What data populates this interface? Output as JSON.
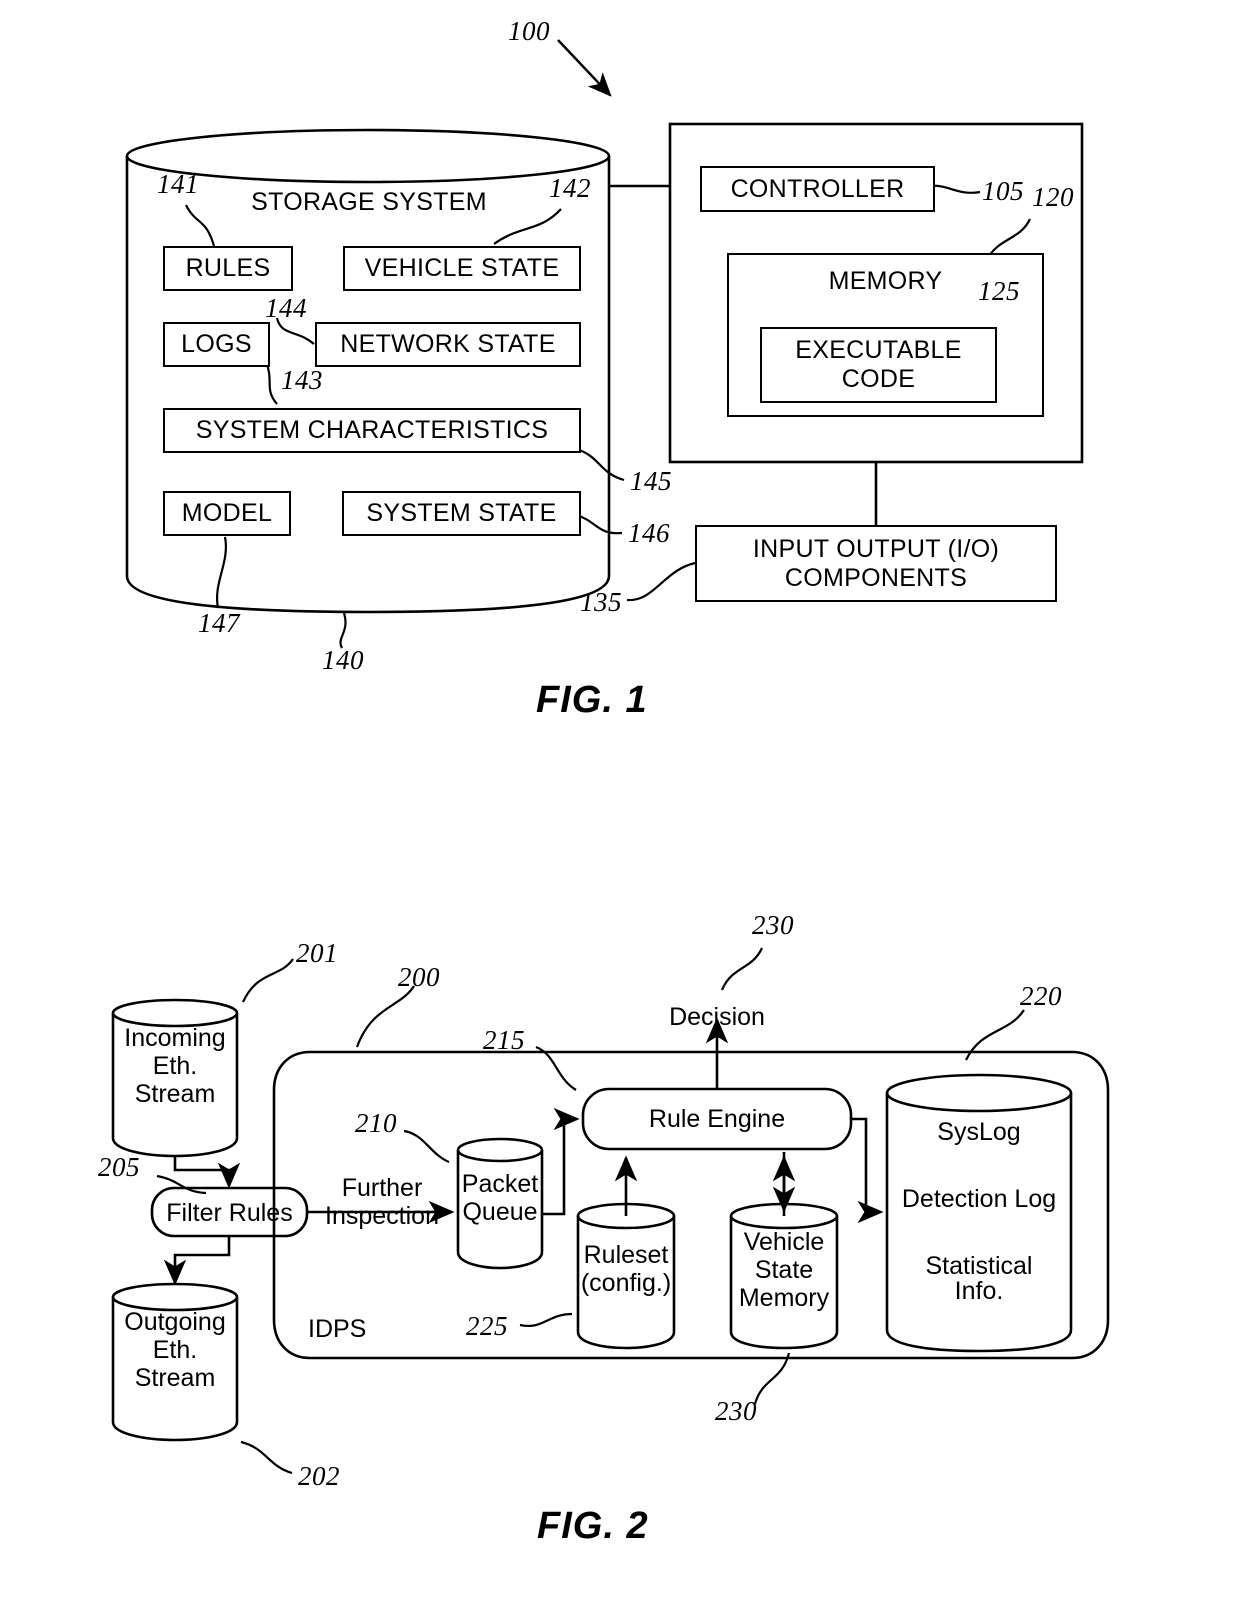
{
  "figures": [
    {
      "id": "fig1",
      "caption": "FIG. 1",
      "system_ref": "100",
      "storage": {
        "title": "STORAGE SYSTEM",
        "ref": "140",
        "items": [
          {
            "label": "RULES",
            "ref": "141"
          },
          {
            "label": "VEHICLE STATE",
            "ref": "142"
          },
          {
            "label": "LOGS",
            "ref": "143"
          },
          {
            "label": "NETWORK STATE",
            "ref": "144"
          },
          {
            "label": "SYSTEM CHARACTERISTICS",
            "ref": "145"
          },
          {
            "label": "MODEL",
            "ref": "147"
          },
          {
            "label": "SYSTEM STATE",
            "ref": "146"
          }
        ]
      },
      "computer": {
        "controller": {
          "label": "CONTROLLER",
          "ref": "105"
        },
        "memory": {
          "label": "MEMORY",
          "ref": "120"
        },
        "executable_code": {
          "label": "EXECUTABLE CODE",
          "line1": "EXECUTABLE",
          "line2": "CODE",
          "ref": "125"
        }
      },
      "io": {
        "line1": "INPUT OUTPUT (I/O)",
        "line2": "COMPONENTS",
        "ref": "135"
      }
    },
    {
      "id": "fig2",
      "caption": "FIG. 2",
      "idps": {
        "label": "IDPS",
        "ref": "200"
      },
      "nodes": [
        {
          "name": "incoming-stream",
          "lines": [
            "Incoming",
            "Eth.",
            "Stream"
          ],
          "ref": "201"
        },
        {
          "name": "outgoing-stream",
          "lines": [
            "Outgoing",
            "Eth.",
            "Stream"
          ],
          "ref": "202"
        },
        {
          "name": "filter-rules",
          "lines": [
            "Filter Rules"
          ],
          "ref": "205"
        },
        {
          "name": "packet-queue",
          "lines": [
            "Packet",
            "Queue"
          ],
          "ref": "210"
        },
        {
          "name": "rule-engine",
          "lines": [
            "Rule Engine"
          ],
          "ref": "215"
        },
        {
          "name": "ruleset",
          "lines": [
            "Ruleset",
            "(config.)"
          ],
          "ref": "225"
        },
        {
          "name": "vehicle-state-memory",
          "lines": [
            "Vehicle",
            "State",
            "Memory"
          ],
          "ref": "230"
        },
        {
          "name": "syslog",
          "lines": [
            "SysLog",
            "Detection Log",
            "Statistical",
            "Info."
          ],
          "ref": "220"
        }
      ],
      "edges": [
        {
          "name": "further-inspection",
          "line1": "Further",
          "line2": "Inspection"
        },
        {
          "name": "decision",
          "label": "Decision",
          "ref": "230"
        }
      ]
    }
  ]
}
